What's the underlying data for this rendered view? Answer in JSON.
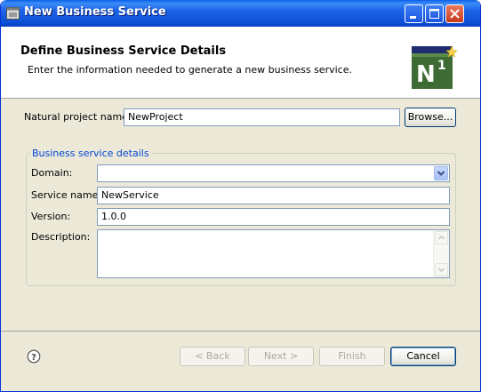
{
  "window": {
    "title": "New Business Service"
  },
  "header": {
    "title": "Define Business Service Details",
    "description": "Enter the information needed to generate a new business service.",
    "logo_text": "N",
    "logo_superscript": "1"
  },
  "project": {
    "label": "Natural project name:",
    "value": "NewProject",
    "browse_label": "Browse..."
  },
  "details": {
    "group_title": "Business service details",
    "domain_label": "Domain:",
    "domain_value": "",
    "service_name_label": "Service name:",
    "service_name_value": "NewService",
    "version_label": "Version:",
    "version_value": "1.0.0",
    "description_label": "Description:",
    "description_value": ""
  },
  "buttons": {
    "back": "< Back",
    "next": "Next >",
    "finish": "Finish",
    "cancel": "Cancel"
  },
  "colors": {
    "titlebar": "#0b4fd6",
    "group_title": "#0046d5",
    "logo_background": "#3d6b33"
  }
}
